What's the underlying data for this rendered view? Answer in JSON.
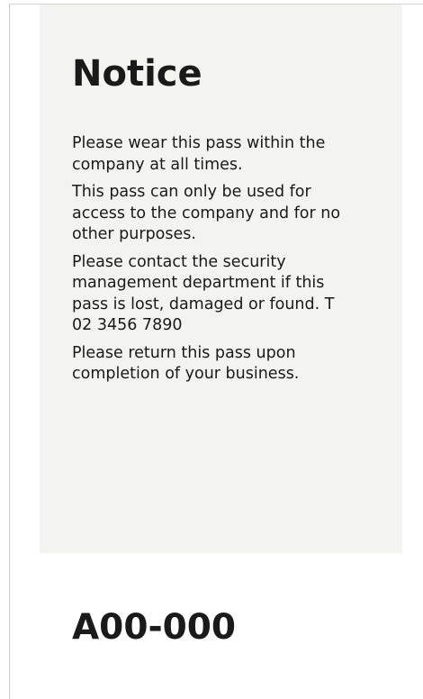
{
  "notice": {
    "title": "Notice",
    "paragraphs": [
      "Please wear this pass within the company at all times.",
      "This pass can only be used for access to the company and for no other purposes.",
      "Please contact the security management department if this pass is lost, damaged or found. T 02 3456 7890",
      "Please return this pass upon completion of your business."
    ]
  },
  "pass": {
    "id": "A00-000"
  },
  "colors": {
    "panel_background": "#f3f3ef",
    "text": "#1a1a1a",
    "page_background": "#ffffff"
  }
}
